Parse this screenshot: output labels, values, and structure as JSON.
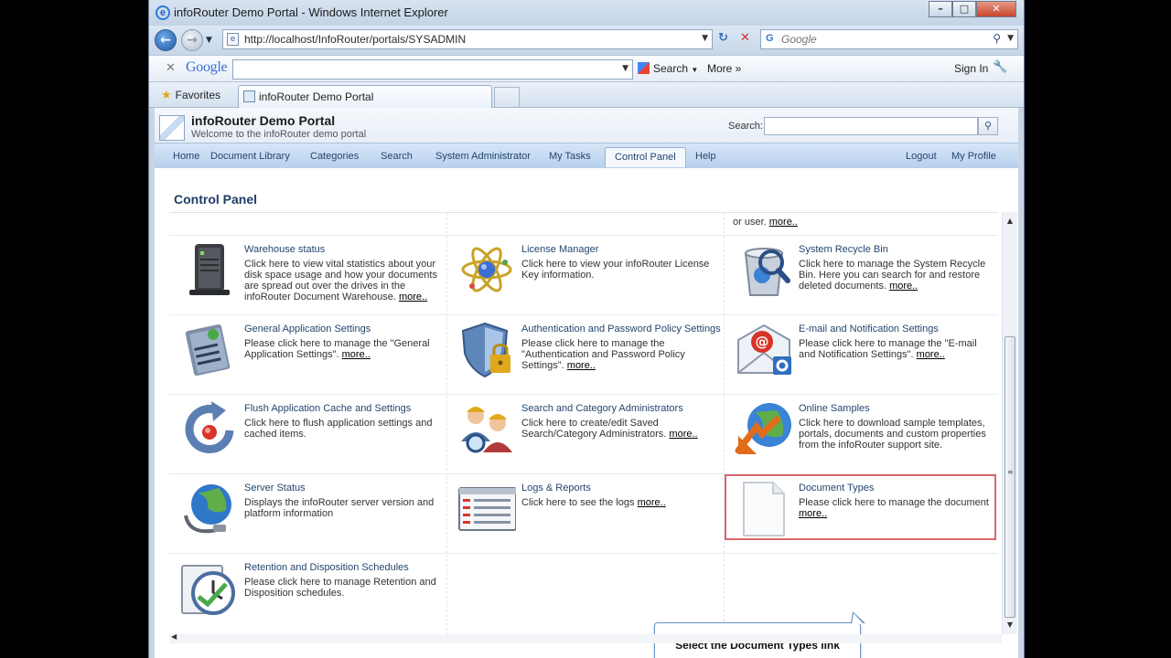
{
  "browser": {
    "window_title": "infoRouter Demo Portal - Windows Internet Explorer",
    "address_url": "http://localhost/InfoRouter/portals/SYSADMIN",
    "search_placeholder": "Google",
    "google_toolbar": {
      "logo_text": "Google",
      "search_label": "Search",
      "more_label": "More »",
      "signin_label": "Sign In"
    },
    "favorites_label": "Favorites",
    "tab_label": "infoRouter Demo Portal"
  },
  "portal": {
    "title": "infoRouter Demo Portal",
    "subtitle": "Welcome to the infoRouter demo portal",
    "search_label": "Search:",
    "nav": [
      "Home",
      "Document Library",
      "Categories",
      "Search",
      "System Administrator",
      "My Tasks",
      "Control Panel",
      "Help"
    ],
    "nav_right": [
      "Logout",
      "My Profile"
    ],
    "active_nav": "Control Panel"
  },
  "page": {
    "title": "Control Panel",
    "prev_tail": "or user.",
    "more_label": "more.."
  },
  "cells": [
    {
      "title": "Warehouse status",
      "desc": "Click here to view vital statistics about your disk space usage and how your documents are spread out over the drives in the infoRouter Document Warehouse.",
      "has_more": true,
      "icon": "server-icon"
    },
    {
      "title": "License Manager",
      "desc": "Click here to view your infoRouter License Key information.",
      "has_more": false,
      "icon": "atom-icon"
    },
    {
      "title": "System Recycle Bin",
      "desc": "Click here to manage the System Recycle Bin. Here you can search for and restore deleted documents.",
      "has_more": true,
      "icon": "recycle-bin-icon"
    },
    {
      "title": "General Application Settings",
      "desc": "Please click here to manage the \"General Application Settings\".",
      "has_more": true,
      "icon": "settings-list-icon"
    },
    {
      "title": "Authentication and Password Policy Settings",
      "desc": "Please click here to manage the \"Authentication and Password Policy Settings\".",
      "has_more": true,
      "icon": "shield-lock-icon"
    },
    {
      "title": "E-mail and Notification Settings",
      "desc": "Please click here to manage the \"E-mail and Notification Settings\".",
      "has_more": true,
      "icon": "email-gear-icon"
    },
    {
      "title": "Flush Application Cache and Settings",
      "desc": "Click here to flush application settings and cached items.",
      "has_more": false,
      "icon": "refresh-icon"
    },
    {
      "title": "Search and Category Administrators",
      "desc": "Click here to create/edit Saved Search/Category Administrators.",
      "has_more": true,
      "icon": "admin-users-icon"
    },
    {
      "title": "Online Samples",
      "desc": "Click here to download sample templates, portals, documents and custom properties from the infoRouter support site.",
      "has_more": false,
      "icon": "globe-download-icon"
    },
    {
      "title": "Server Status",
      "desc": "Displays the infoRouter server version and platform information",
      "has_more": false,
      "icon": "globe-network-icon"
    },
    {
      "title": "Logs & Reports",
      "desc": "Click here to see the logs",
      "has_more": true,
      "icon": "log-window-icon"
    },
    {
      "title": "Document Types",
      "desc": "Please click here to manage the document",
      "has_more": true,
      "icon": "document-icon"
    },
    {
      "title": "Retention and Disposition Schedules",
      "desc": "Please click here to manage Retention and Disposition schedules.",
      "has_more": false,
      "icon": "clock-icon"
    }
  ],
  "callout": {
    "text": "Select the Document Types link"
  }
}
